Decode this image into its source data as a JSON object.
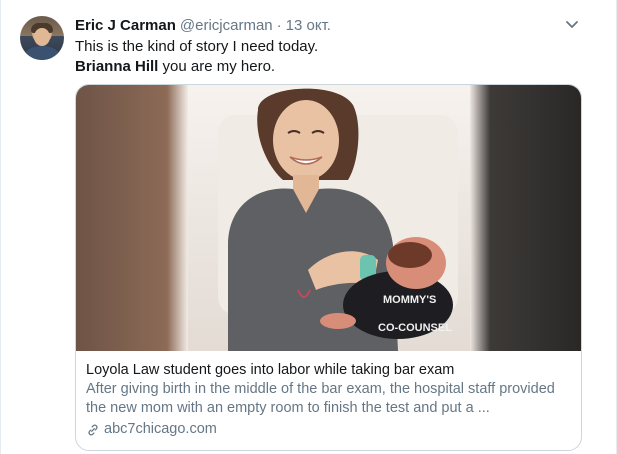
{
  "tweet": {
    "author_name": "Eric J Carman",
    "author_handle": "@ericjcarman",
    "separator": "·",
    "date": "13 окт.",
    "line1": "This is the kind of story I need today.",
    "mention_bold": "Brianna Hill",
    "line2_rest": " you are my hero."
  },
  "card": {
    "title": "Loyola Law student goes into labor while taking bar exam",
    "description": "After giving birth in the middle of the bar exam, the hospital staff provided the new mom with an empty room to finish the test and put a ...",
    "domain": "abc7chicago.com",
    "image_alt": "Mother smiling while holding and bottle-feeding newborn wearing a Mommy's Co-Counsel onesie",
    "onesie_text": [
      "MOMMY'S",
      "CO-COUNSEL"
    ]
  },
  "icons": {
    "menu": "chevron-down-icon",
    "link": "link-icon"
  },
  "colors": {
    "text_primary": "#14171a",
    "text_secondary": "#657786",
    "border": "#ccd6dd"
  }
}
